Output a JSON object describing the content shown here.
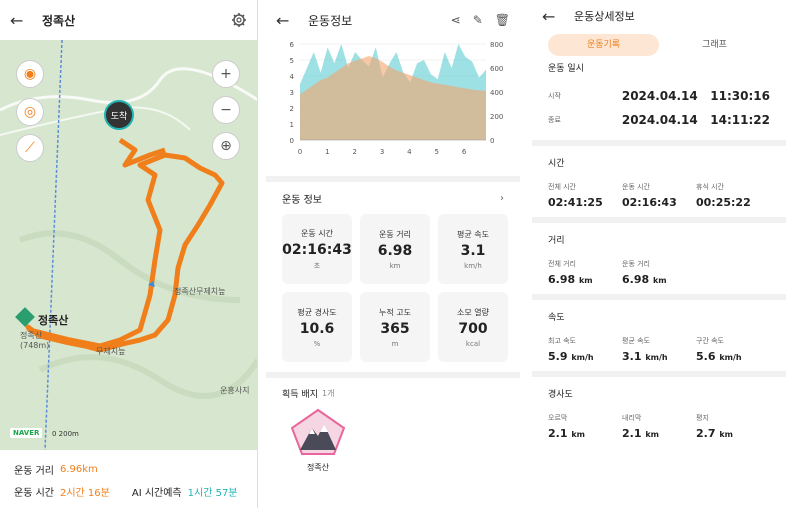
{
  "panel1": {
    "title": "정족산",
    "end_label": "도착",
    "map_labels": {
      "peak_name": "정족산",
      "peak_sub": "정족산",
      "peak_alt": "(748m)",
      "mujechineup": "정족산무제치늪",
      "mujechi": "무제치늪",
      "unamsaji": "운흥사지",
      "naver": "NAVER",
      "scale": "0    200m"
    },
    "info": {
      "distance_label": "운동 거리",
      "distance_value": "6.96km",
      "time_label": "운동 시간",
      "time_value": "2시간 16분",
      "ai_label": "AI 시간예측",
      "ai_value": "1시간 57분"
    },
    "accent": "#f07f1b",
    "teal": "#22b3b3"
  },
  "panel2": {
    "title": "운동정보",
    "chart_data": {
      "type": "area",
      "x_ticks": [
        "0",
        "1",
        "2",
        "3",
        "4",
        "5",
        "6"
      ],
      "y_left_ticks": [
        "6",
        "5",
        "4",
        "3",
        "2",
        "1",
        "0"
      ],
      "y_right_ticks": [
        "800",
        "600",
        "400",
        "200",
        "0"
      ],
      "series": [
        {
          "values": [
            3.5,
            4.5,
            5.5,
            4.2,
            5.8,
            4.8,
            6,
            4.5,
            5.5,
            5,
            4.6,
            5.8,
            3.9,
            4.8,
            5.5,
            4.2,
            3.6,
            4.8,
            5,
            4.1,
            3.8,
            5.5,
            4.5,
            6,
            5.2,
            4.9,
            3.9,
            4.4
          ]
        },
        {
          "values": [
            380,
            420,
            460,
            500,
            520,
            560,
            600,
            640,
            660,
            680,
            700,
            680,
            650,
            610,
            580,
            560,
            540,
            520,
            500,
            480,
            470,
            460,
            450,
            440,
            430,
            420,
            415,
            410
          ]
        }
      ],
      "xlim": [
        0,
        6.8
      ],
      "ylim_left": [
        0,
        6
      ],
      "ylim_right": [
        0,
        800
      ]
    },
    "section_title": "운동 정보",
    "stats": [
      {
        "label": "운동 시간",
        "value": "02:16:43",
        "unit": "초"
      },
      {
        "label": "운동 거리",
        "value": "6.98",
        "unit": "km"
      },
      {
        "label": "평균 속도",
        "value": "3.1",
        "unit": "km/h"
      },
      {
        "label": "평균 경사도",
        "value": "10.6",
        "unit": "%"
      },
      {
        "label": "누적 고도",
        "value": "365",
        "unit": "m"
      },
      {
        "label": "소모 열량",
        "value": "700",
        "unit": "kcal"
      }
    ],
    "badge_title": "획득 배지",
    "badge_count": "1개",
    "badge_name": "정족산"
  },
  "panel3": {
    "title": "운동상세정보",
    "tabs": [
      "운동기록",
      "그래프"
    ],
    "date_section": "운동 일시",
    "start_label": "시작",
    "start_value": "2024.04.14   11:30:16",
    "end_label": "종료",
    "end_value": "2024.04.14   14:11:22",
    "time_section": "시간",
    "time_items": [
      {
        "label": "전체 시간",
        "value": "02:41:25"
      },
      {
        "label": "운동 시간",
        "value": "02:16:43"
      },
      {
        "label": "휴식 시간",
        "value": "00:25:22"
      }
    ],
    "dist_section": "거리",
    "dist_items": [
      {
        "label": "전체 거리",
        "value": "6.98",
        "unit": "km"
      },
      {
        "label": "운동 거리",
        "value": "6.98",
        "unit": "km"
      }
    ],
    "speed_section": "속도",
    "speed_items": [
      {
        "label": "최고 속도",
        "value": "5.9",
        "unit": "km/h"
      },
      {
        "label": "평균 속도",
        "value": "3.1",
        "unit": "km/h"
      },
      {
        "label": "구간 속도",
        "value": "5.6",
        "unit": "km/h"
      }
    ],
    "slope_section": "경사도",
    "slope_items": [
      {
        "label": "오르막",
        "value": "2.1",
        "unit": "km"
      },
      {
        "label": "내리막",
        "value": "2.1",
        "unit": "km"
      },
      {
        "label": "평지",
        "value": "2.7",
        "unit": "km"
      }
    ]
  }
}
